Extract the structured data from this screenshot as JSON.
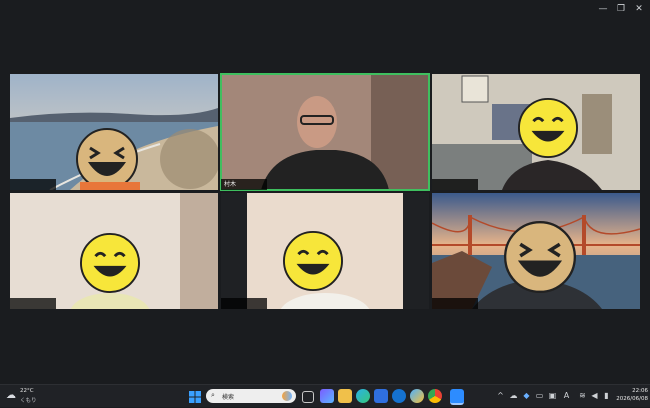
{
  "window": {
    "controls": [
      "—",
      "❐",
      "✕"
    ]
  },
  "participants": [
    {
      "name": "",
      "scene": "beach"
    },
    {
      "name": "村木",
      "scene": "room",
      "speaking": true
    },
    {
      "name": "",
      "scene": "shelf"
    },
    {
      "name": "",
      "scene": "wall"
    },
    {
      "name": "",
      "scene": "wall"
    },
    {
      "name": "",
      "scene": "bridge"
    }
  ],
  "taskbar": {
    "weather_temp": "22°C",
    "weather_desc": "くもり",
    "search_placeholder": "検索",
    "tray_lang": "A",
    "time": "22:06",
    "date": "2026/06/08"
  },
  "colors": {
    "active_border": "#3fbf5f",
    "taskbar": "#202226",
    "background": "#1a1c1f"
  },
  "icons": [
    "windows-start-icon",
    "search-icon",
    "task-view-icon",
    "teams-icon",
    "file-explorer-icon",
    "edge-icon",
    "store-icon",
    "hp-icon",
    "photos-icon",
    "chrome-icon",
    "zoom-icon"
  ]
}
